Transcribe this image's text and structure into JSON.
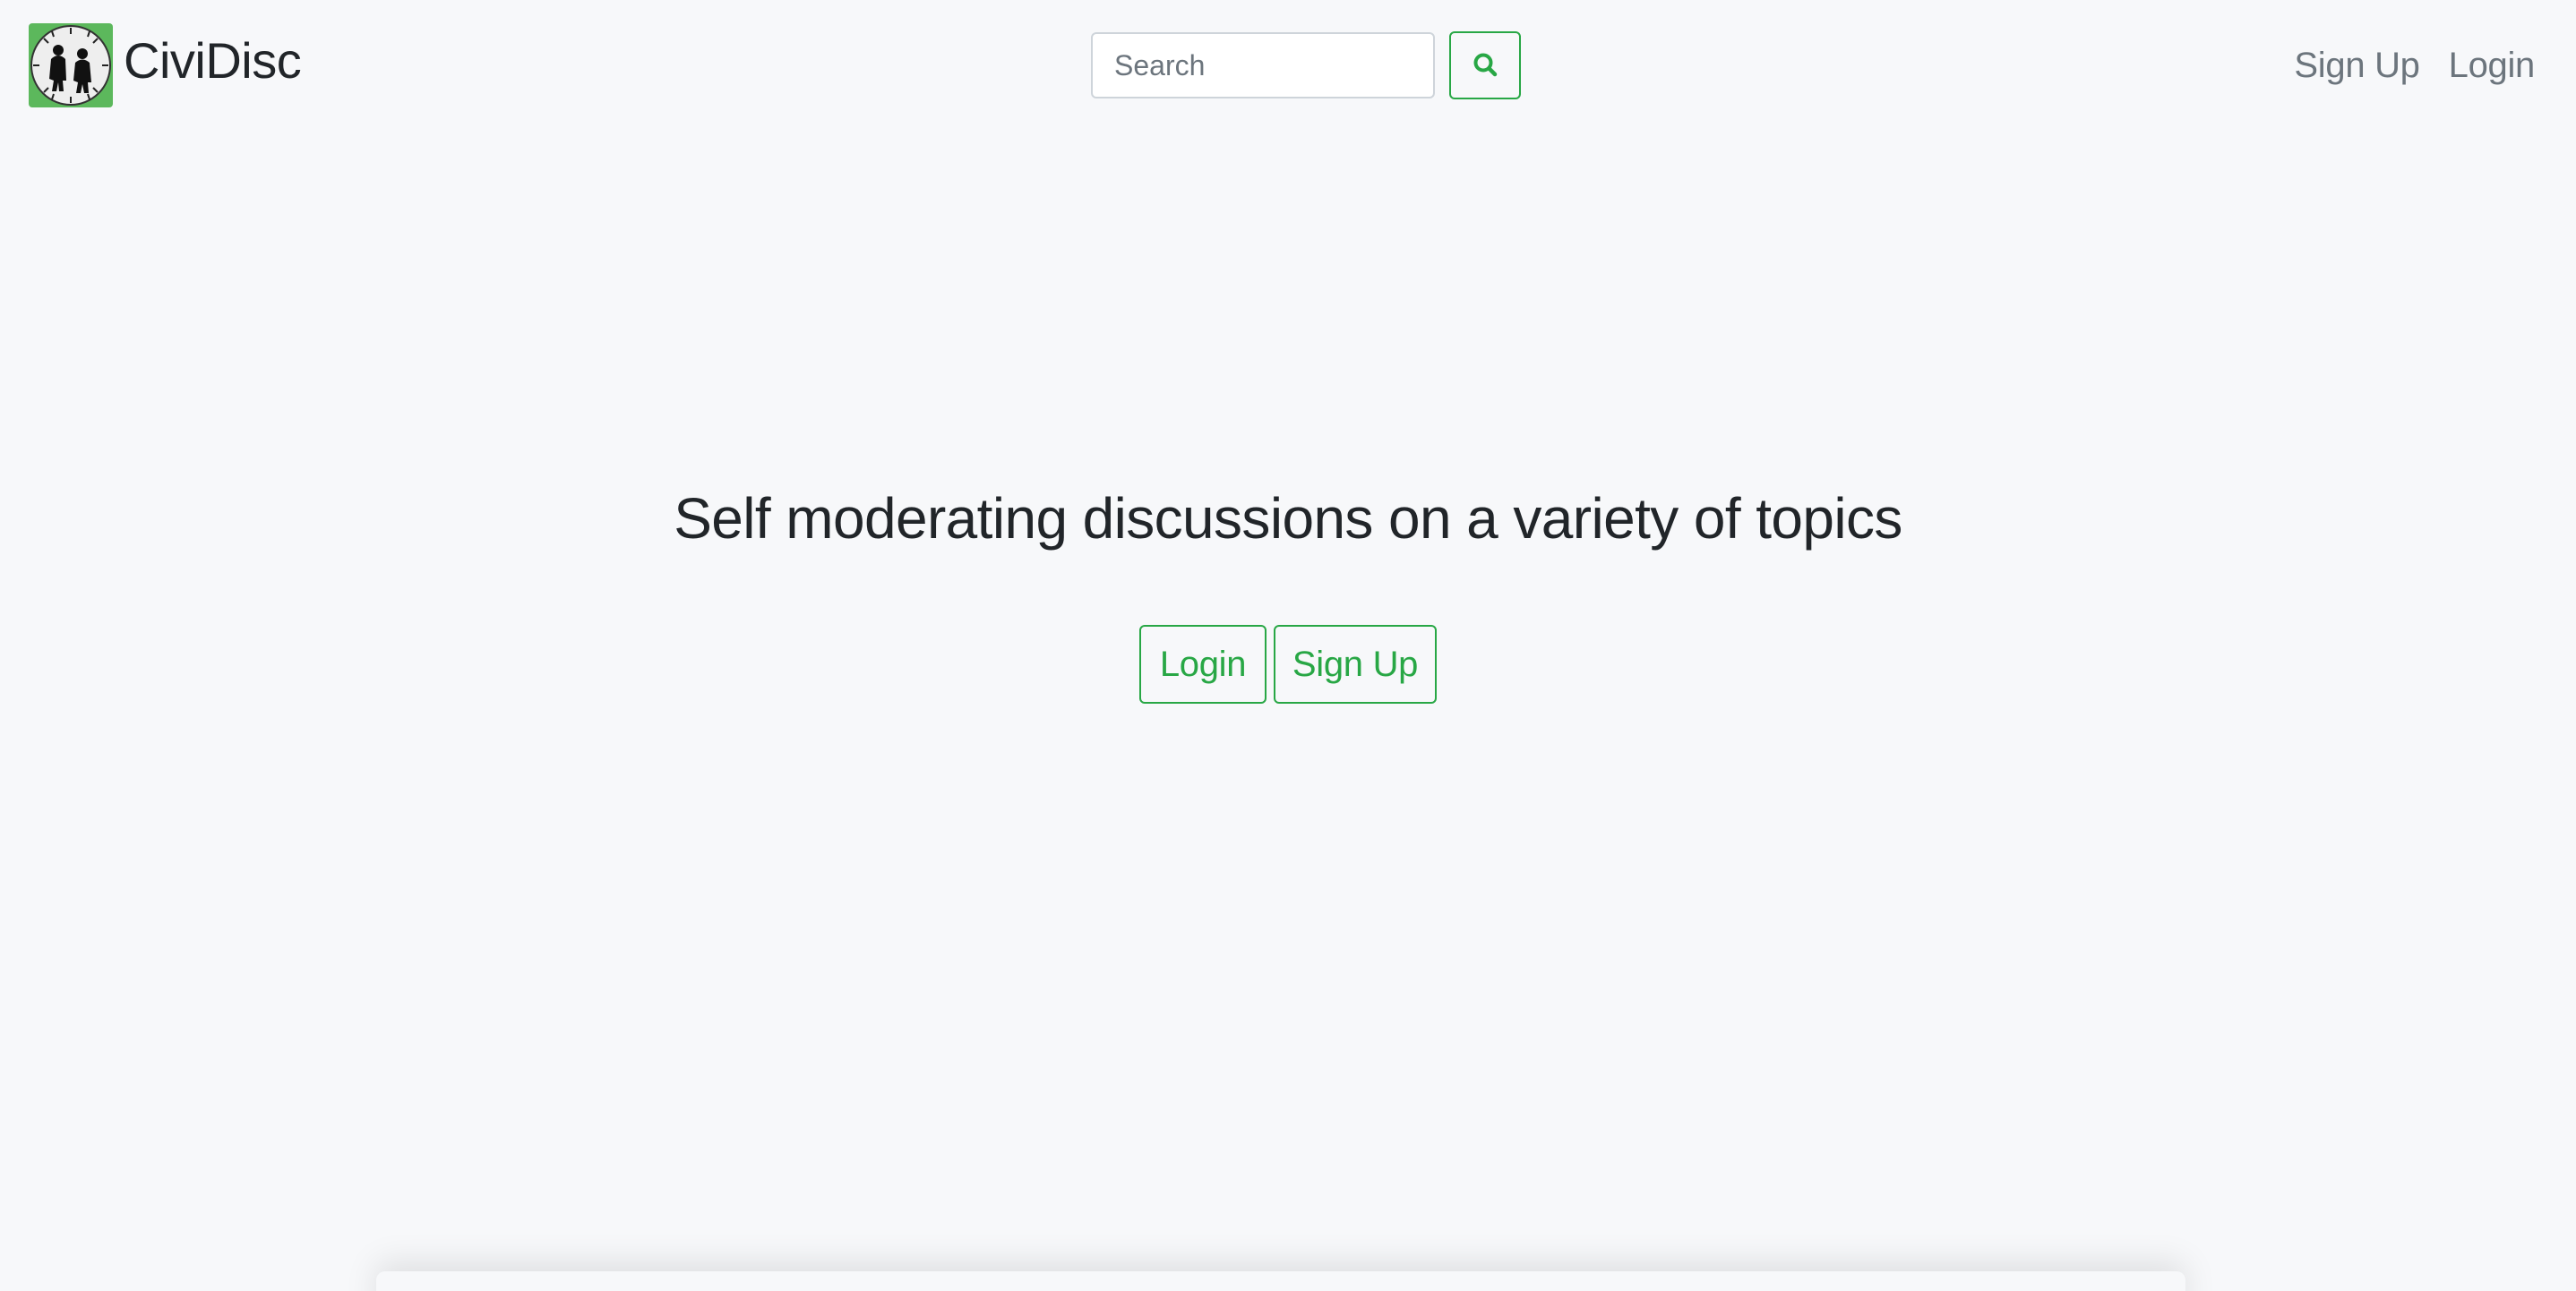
{
  "brand": {
    "name": "CiviDisc",
    "logo_icon": "two-figures-clock-logo",
    "logo_bg_color": "#5cb85c"
  },
  "search": {
    "placeholder": "Search",
    "value": "",
    "button_icon": "search-icon"
  },
  "nav": {
    "items": [
      {
        "label": "Sign Up"
      },
      {
        "label": "Login"
      }
    ]
  },
  "hero": {
    "title": "Self moderating discussions on a variety of topics",
    "login_label": "Login",
    "signup_label": "Sign Up"
  },
  "colors": {
    "accent": "#28a745",
    "background": "#f7f8fa",
    "muted_text": "#6c757d",
    "text": "#212529"
  }
}
